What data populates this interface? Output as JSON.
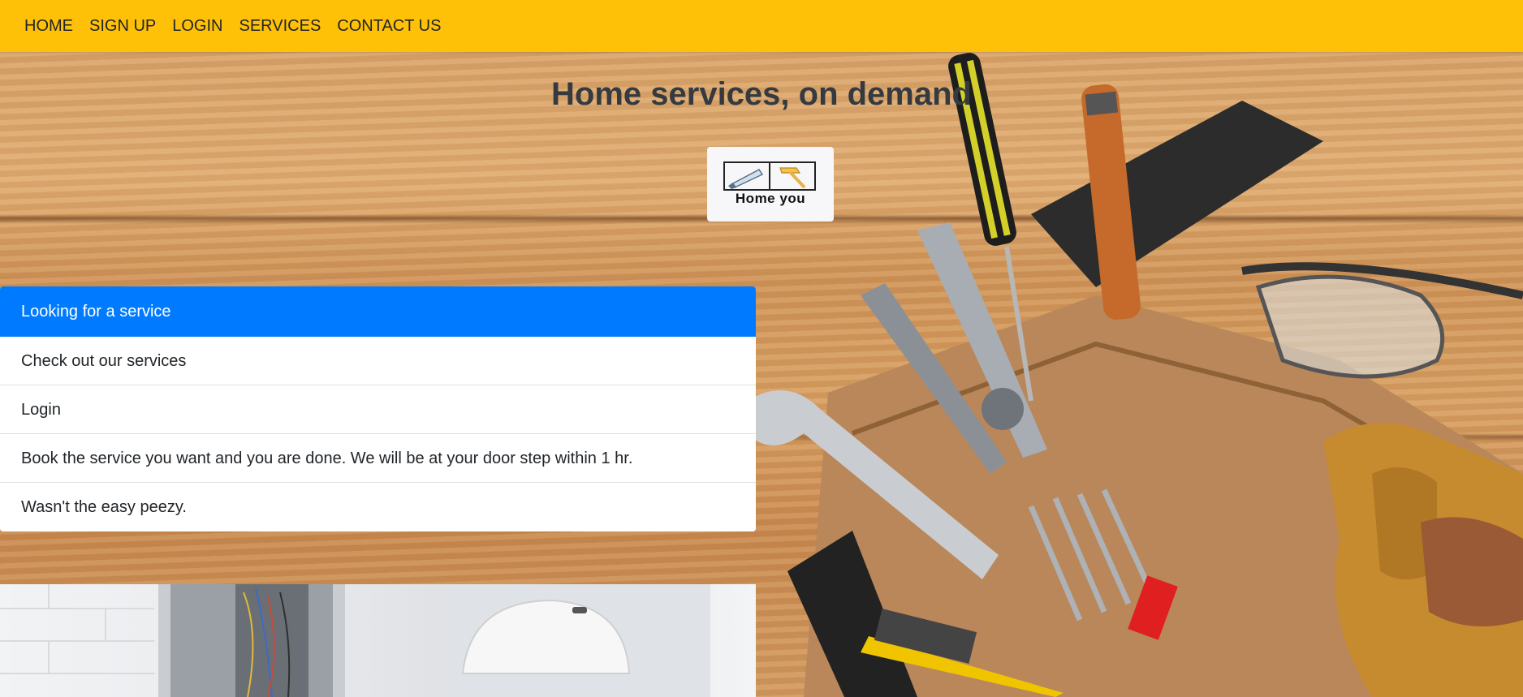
{
  "nav": {
    "items": [
      "HOME",
      "SIGN UP",
      "LOGIN",
      "SERVICES",
      "CONTACT US"
    ]
  },
  "hero": {
    "title": "Home services, on demand"
  },
  "logo": {
    "text": "Home you",
    "icons": [
      "saw-icon",
      "hammer-icon"
    ]
  },
  "list": {
    "header": "Looking for a service",
    "items": [
      "Check out our services",
      "Login",
      "Book the service you want and you are done. We will be at your door step within 1 hr.",
      "Wasn't the easy peezy."
    ]
  },
  "colors": {
    "navbar": "#ffc107",
    "active": "#007bff",
    "title": "#343a40"
  }
}
